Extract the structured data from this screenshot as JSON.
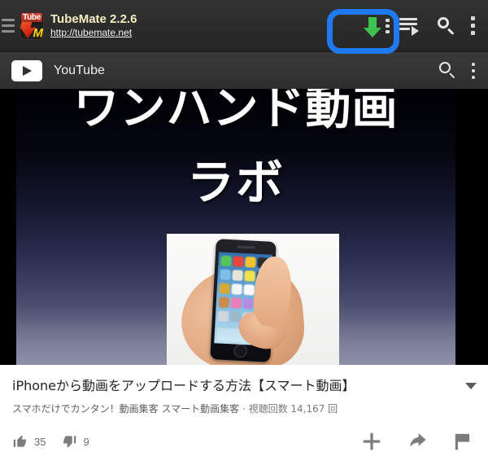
{
  "tubemate_bar": {
    "menu_icon": "hamburger-icon",
    "logo": {
      "icon": "tubemate-logo-icon",
      "badge_word": "Tube",
      "letter": "M"
    },
    "app_title": "TubeMate 2.2.6",
    "app_url": "http://tubemate.net",
    "download_icon": "download-arrow-icon",
    "download_menu_icon": "download-options-dots-icon",
    "playlist_icon": "playlist-play-icon",
    "search_icon": "search-icon",
    "overflow_icon": "overflow-menu-icon",
    "highlight_color": "#1f7af0",
    "download_arrow_color": "#3fc14f"
  },
  "youtube_bar": {
    "logo_icon": "youtube-play-logo-icon",
    "label": "YouTube",
    "search_icon": "search-icon",
    "overflow_icon": "overflow-menu-icon"
  },
  "player": {
    "overlay_line1": "ワンハンド動画",
    "overlay_line2": "ラボ",
    "photo_description": "hand-holding-iphone-photo"
  },
  "video_info": {
    "title": "iPhoneから動画をアップロードする方法【スマート動画】",
    "expand_icon": "expand-description-caret-icon",
    "channel": "スマホだけでカンタン！動画集客 スマート動画集客",
    "separator": " · ",
    "views": "視聴回数 14,167 回",
    "likes": "35",
    "dislikes": "9",
    "like_icon": "thumbs-up-icon",
    "dislike_icon": "thumbs-down-icon",
    "add_icon": "add-to-playlist-icon",
    "share_icon": "share-arrow-icon",
    "flag_icon": "report-flag-icon"
  }
}
